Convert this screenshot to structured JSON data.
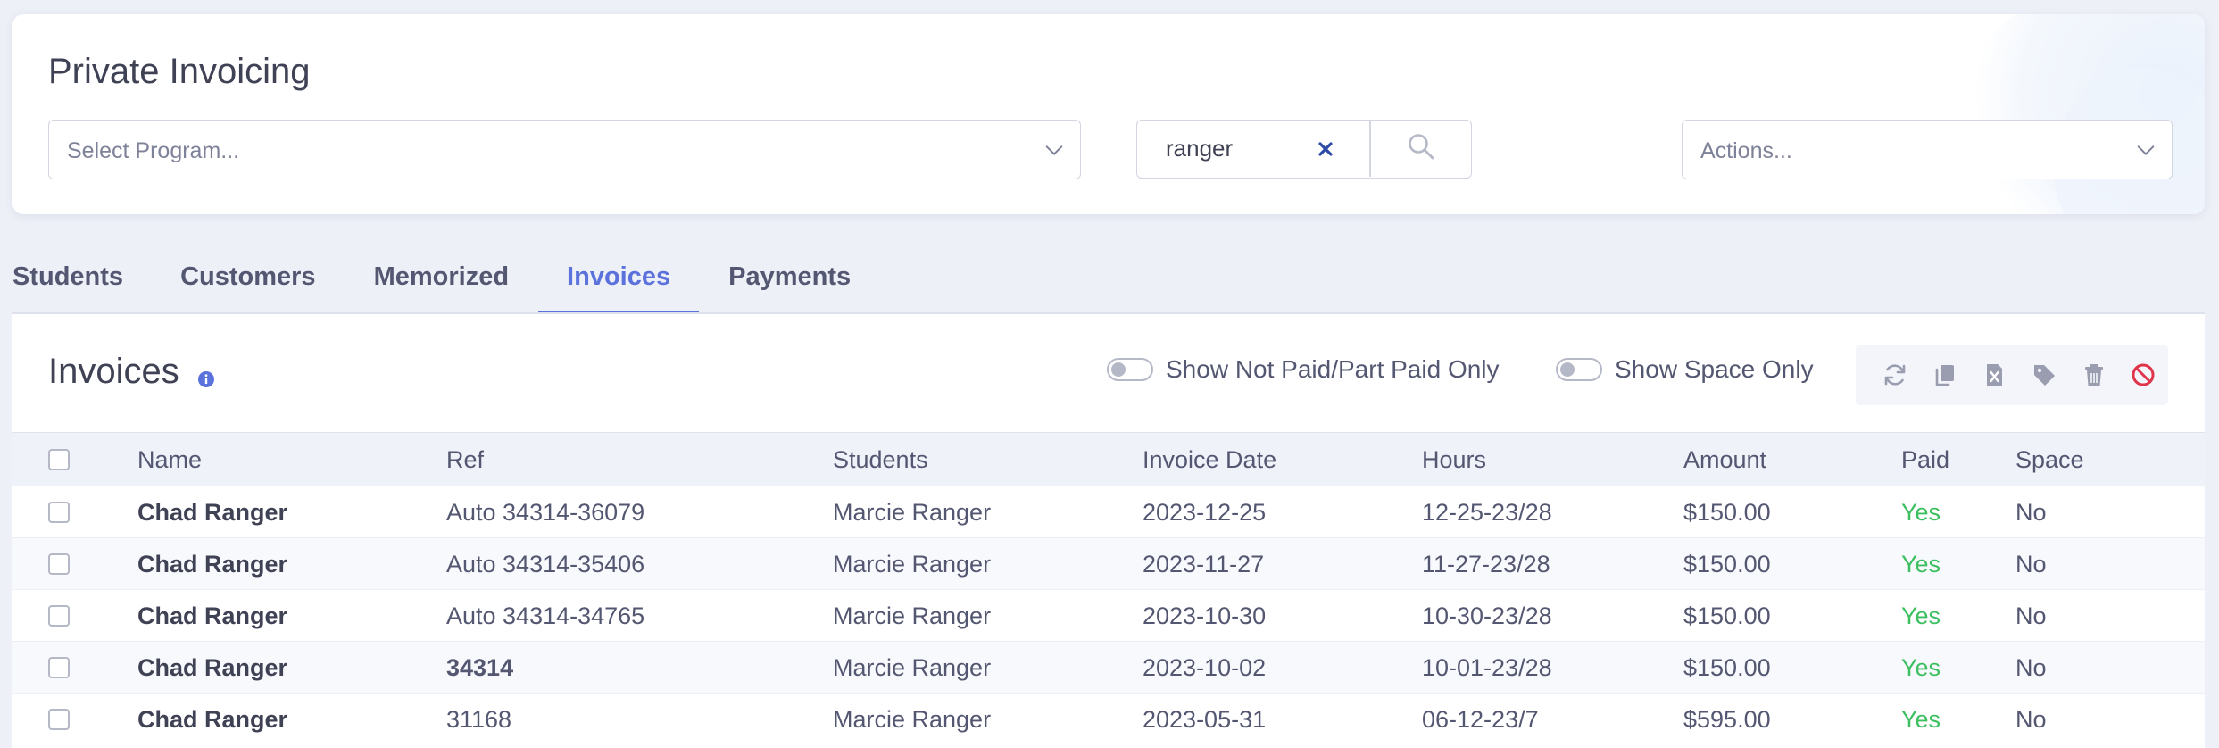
{
  "header": {
    "title": "Private Invoicing",
    "program_placeholder": "Select Program...",
    "search_value": "ranger",
    "actions_placeholder": "Actions..."
  },
  "tabs": [
    {
      "label": "Students",
      "active": false
    },
    {
      "label": "Customers",
      "active": false
    },
    {
      "label": "Memorized",
      "active": false
    },
    {
      "label": "Invoices",
      "active": true
    },
    {
      "label": "Payments",
      "active": false
    }
  ],
  "invoices": {
    "title": "Invoices",
    "toggle_not_paid_label": "Show Not Paid/Part Paid Only",
    "toggle_not_paid_on": false,
    "toggle_space_label": "Show Space Only",
    "toggle_space_on": false,
    "toolbar_icons": [
      "refresh-icon",
      "copy-icon",
      "excel-export-icon",
      "tag-icon",
      "trash-icon",
      "ban-icon"
    ],
    "columns": [
      "Name",
      "Ref",
      "Students",
      "Invoice Date",
      "Hours",
      "Amount",
      "Paid",
      "Space"
    ],
    "rows": [
      {
        "name": "Chad Ranger",
        "ref": "Auto 34314-36079",
        "ref_bold": false,
        "students": "Marcie Ranger",
        "date": "2023-12-25",
        "hours": "12-25-23/28",
        "amount": "$150.00",
        "paid": "Yes",
        "space": "No"
      },
      {
        "name": "Chad Ranger",
        "ref": "Auto 34314-35406",
        "ref_bold": false,
        "students": "Marcie Ranger",
        "date": "2023-11-27",
        "hours": "11-27-23/28",
        "amount": "$150.00",
        "paid": "Yes",
        "space": "No"
      },
      {
        "name": "Chad Ranger",
        "ref": "Auto 34314-34765",
        "ref_bold": false,
        "students": "Marcie Ranger",
        "date": "2023-10-30",
        "hours": "10-30-23/28",
        "amount": "$150.00",
        "paid": "Yes",
        "space": "No"
      },
      {
        "name": "Chad Ranger",
        "ref": "34314",
        "ref_bold": true,
        "students": "Marcie Ranger",
        "date": "2023-10-02",
        "hours": "10-01-23/28",
        "amount": "$150.00",
        "paid": "Yes",
        "space": "No"
      },
      {
        "name": "Chad Ranger",
        "ref": "31168",
        "ref_bold": false,
        "students": "Marcie Ranger",
        "date": "2023-05-31",
        "hours": "06-12-23/7",
        "amount": "$595.00",
        "paid": "Yes",
        "space": "No"
      }
    ]
  },
  "colors": {
    "accent": "#5b72dd",
    "paid_yes": "#3bbf5f",
    "danger": "#e0344b",
    "background": "#eef0f8"
  }
}
